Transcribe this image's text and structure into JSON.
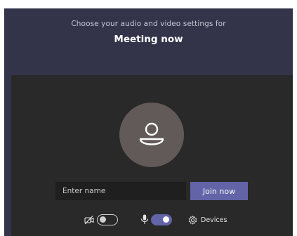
{
  "header": {
    "subtitle": "Choose your audio and video settings for",
    "title": "Meeting now"
  },
  "avatar": {
    "icon": "person-icon"
  },
  "join_form": {
    "name_placeholder": "Enter name",
    "name_value": "",
    "join_label": "Join now"
  },
  "controls": {
    "camera": {
      "icon": "camera-off-icon",
      "state": "off"
    },
    "microphone": {
      "icon": "microphone-icon",
      "state": "on"
    },
    "devices_label": "Devices",
    "devices_icon": "gear-icon"
  },
  "colors": {
    "window_bg": "#33344a",
    "panel_bg": "#292929",
    "avatar_bg": "#625a58",
    "accent": "#6264a7"
  }
}
